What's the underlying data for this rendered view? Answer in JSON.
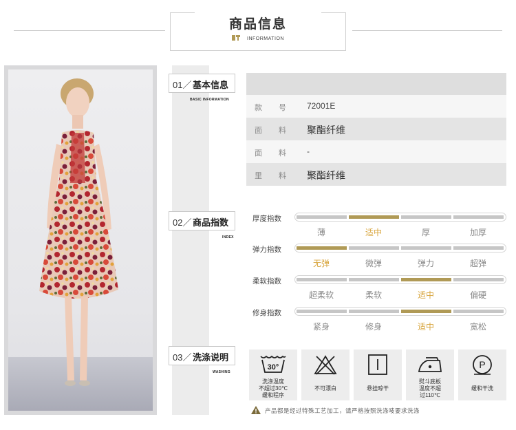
{
  "header": {
    "title": "商品信息",
    "subtitle": "INFORMATION"
  },
  "sections": {
    "basic": {
      "num": "01／",
      "title": "基本信息",
      "sub": "BASIC INFORMATION"
    },
    "index": {
      "num": "02／",
      "title": "商品指数",
      "sub": "INDEX"
    },
    "washing": {
      "num": "03／",
      "title": "洗涤说明",
      "sub": "WASHING"
    }
  },
  "info_rows": [
    {
      "label": "款号",
      "value": "72001E"
    },
    {
      "label": "面料",
      "value": "聚酯纤维"
    },
    {
      "label": "面料",
      "value": "-"
    },
    {
      "label": "里料",
      "value": "聚酯纤维"
    }
  ],
  "indexes": [
    {
      "label": "厚度指数",
      "options": [
        "薄",
        "适中",
        "厚",
        "加厚"
      ],
      "selected_index": 1
    },
    {
      "label": "弹力指数",
      "options": [
        "无弹",
        "微弹",
        "弹力",
        "超弹"
      ],
      "selected_index": 0
    },
    {
      "label": "柔软指数",
      "options": [
        "超柔软",
        "柔软",
        "适中",
        "偏硬"
      ],
      "selected_index": 2
    },
    {
      "label": "修身指数",
      "options": [
        "紧身",
        "修身",
        "适中",
        "宽松"
      ],
      "selected_index": 2
    }
  ],
  "washing": [
    {
      "icon": "wash-30-icon",
      "lines": [
        "洗涤温度",
        "不超过30℃",
        "缓和程序"
      ]
    },
    {
      "icon": "no-bleach-icon",
      "lines": [
        "不可漂白"
      ]
    },
    {
      "icon": "hang-dry-icon",
      "lines": [
        "悬挂晾干"
      ]
    },
    {
      "icon": "iron-low-icon",
      "lines": [
        "熨斗底板",
        "温度不超",
        "过110℃"
      ]
    },
    {
      "icon": "dry-clean-p-icon",
      "lines": [
        "缓和干洗"
      ]
    }
  ],
  "wash_badge_temp": "30°",
  "dry_clean_letter": "P",
  "warning": "产品都是经过特殊工艺加工，请严格按照洗涤唛要求洗涤",
  "colors": {
    "accent_gold": "#b09a56",
    "selected_text": "#d8a53d",
    "bar_gray": "#c6c6c6"
  }
}
